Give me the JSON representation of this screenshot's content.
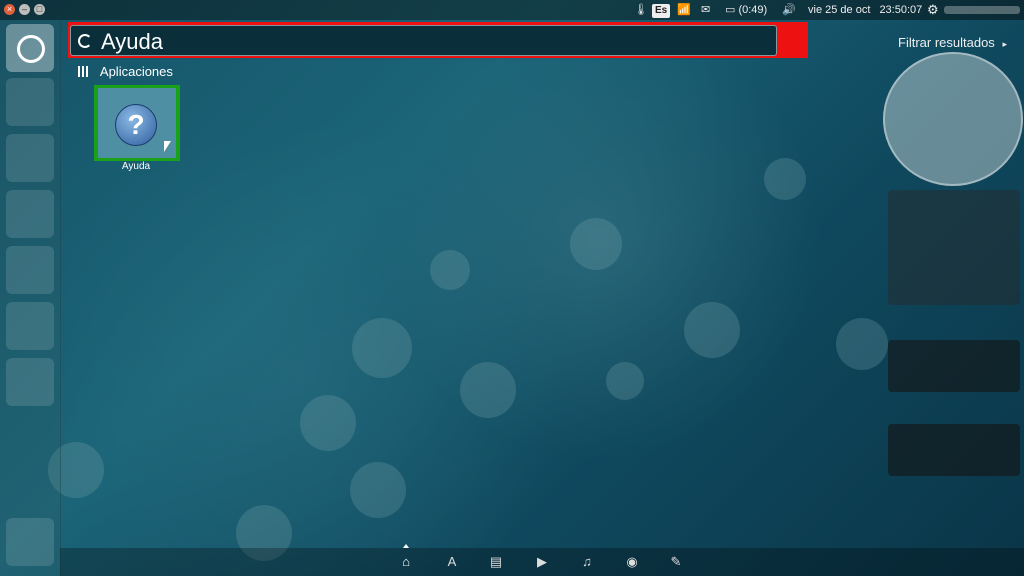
{
  "top_panel": {
    "keyboard_layout": "Es",
    "battery_time": "(0:49)",
    "date": "vie 25 de oct",
    "time": "23:50:07"
  },
  "search": {
    "query": "Ayuda"
  },
  "filter": {
    "label": "Filtrar resultados",
    "arrow": "▸"
  },
  "category": {
    "label": "Aplicaciones"
  },
  "results": [
    {
      "label": "Ayuda",
      "icon": "help-icon"
    }
  ],
  "launcher": {
    "icons": [
      "ubuntu-dash-icon",
      "files-icon",
      "chromium-icon",
      "document-icon",
      "software-center-icon",
      "terminal-icon",
      "settings-icon",
      "trash-icon"
    ]
  },
  "lenses": [
    "home-lens-icon",
    "apps-lens-icon",
    "files-lens-icon",
    "video-lens-icon",
    "music-lens-icon",
    "photos-lens-icon",
    "social-lens-icon"
  ],
  "colors": {
    "search_highlight": "#ee1111",
    "result_highlight": "#1aa11a"
  }
}
